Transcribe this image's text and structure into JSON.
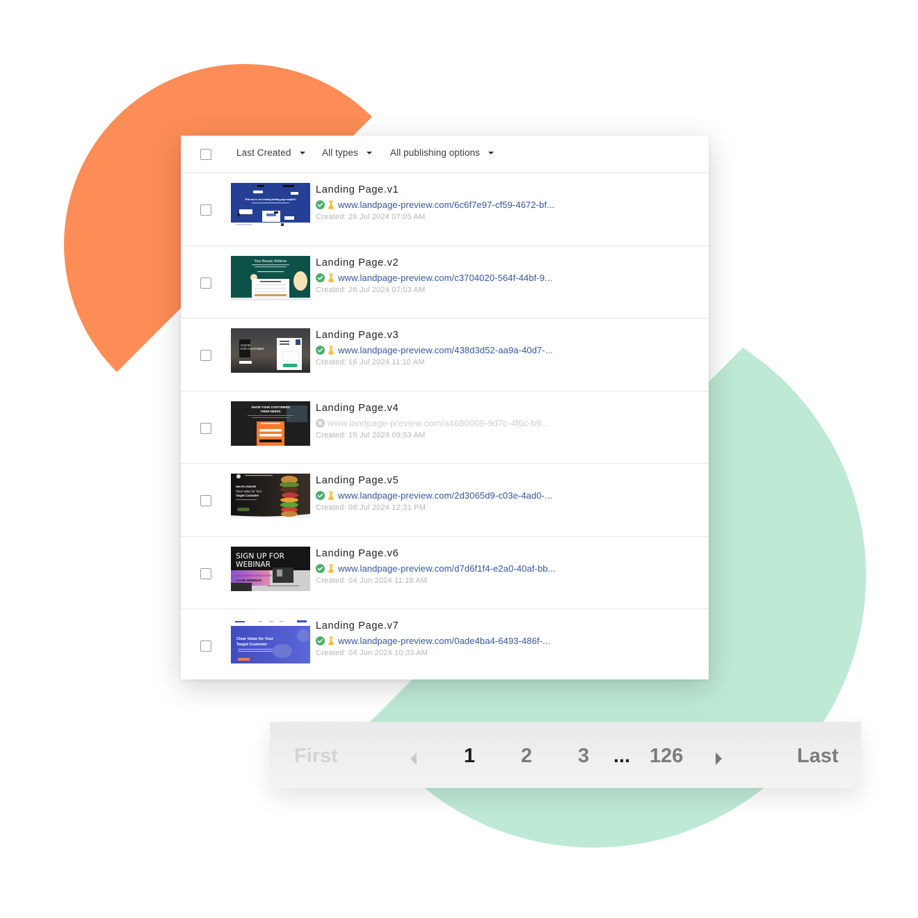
{
  "colors": {
    "orange_shape": "#fd8d56",
    "green_shape": "#bde9d5",
    "link": "#34559c",
    "status_ok": "#4caf6a",
    "status_off": "#cfcfcf",
    "flask": "#f5b731"
  },
  "toolbar": {
    "select_all_checked": false,
    "filters": [
      {
        "label": "Last Created"
      },
      {
        "label": "All types"
      },
      {
        "label": "All publishing options"
      }
    ]
  },
  "pages": [
    {
      "title": "Landing Page.v1",
      "status": "published",
      "ab_test": true,
      "url": "www.landpage-preview.com/6c6f7e97-cf59-4672-bf...",
      "created": "Created: 26 Jul 2024 07:05 AM",
      "thumb": "training-template",
      "thumb_text": "Welcome to our training landing page template!"
    },
    {
      "title": "Landing Page.v2",
      "status": "published",
      "ab_test": true,
      "url": "www.landpage-preview.com/c3704020-564f-44bf-9...",
      "created": "Created: 26 Jul 2024 07:03 AM",
      "thumb": "beauty-webinar",
      "thumb_text": "Your Beauty Webinar"
    },
    {
      "title": "Landing Page.v3",
      "status": "published",
      "ab_test": true,
      "url": "www.landpage-preview.com/438d3d52-aa9a-40d7-...",
      "created": "Created: 16 Jul 2024 11:10 AM",
      "thumb": "clear-value-dark",
      "thumb_text": "CLEAR VALUE FOR CUSTOMER"
    },
    {
      "title": "Landing Page.v4",
      "status": "unpublished",
      "ab_test": false,
      "url": "www.landpage-preview.com/a4680009-9d7c-4f6c-b9...",
      "created": "Created: 15 Jul 2024 09:53 AM",
      "thumb": "customers-needs",
      "thumb_text": "SHOW YOUR CUSTOMERS THEIR NEEDS"
    },
    {
      "title": "Landing Page.v5",
      "status": "published",
      "ab_test": true,
      "url": "www.landpage-preview.com/2d3065d9-c03e-4ad0-...",
      "created": "Created: 08 Jul 2024 12:31 PM",
      "thumb": "burger",
      "thumb_text": "Clear Value for Your Target Customer"
    },
    {
      "title": "Landing Page.v6",
      "status": "published",
      "ab_test": true,
      "url": "www.landpage-preview.com/d7d6f1f4-e2a0-40af-bb...",
      "created": "Created: 04 Jun 2024 11:18 AM",
      "thumb": "signup-webinar",
      "thumb_text": "SIGN UP FOR WEBINAR"
    },
    {
      "title": "Landing Page.v7",
      "status": "published",
      "ab_test": true,
      "url": "www.landpage-preview.com/0ade4ba4-6493-486f-...",
      "created": "Created: 04 Jun 2024 10:33 AM",
      "thumb": "clear-value-blue",
      "thumb_text": "Clear Value for Your Target Customer"
    }
  ],
  "pagination": {
    "first_label": "First",
    "last_label": "Last",
    "pages": [
      "1",
      "2",
      "3"
    ],
    "ellipsis": "...",
    "total_pages": "126",
    "current_page": "1"
  }
}
